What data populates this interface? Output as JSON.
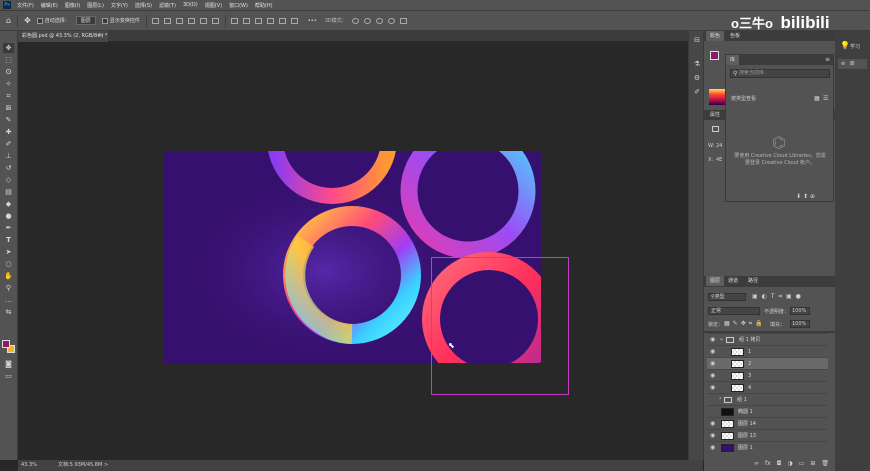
{
  "app": {
    "menus": [
      "文件(F)",
      "编辑(E)",
      "图像(I)",
      "图层(L)",
      "文字(Y)",
      "选择(S)",
      "滤镜(T)",
      "3D(D)",
      "视图(V)",
      "窗口(W)",
      "帮助(H)"
    ],
    "ps_logo": "Ps"
  },
  "options_bar": {
    "auto_select_label": "自动选择：",
    "auto_select_value": "图层",
    "show_transform_label": "显示变换控件",
    "more": "•••"
  },
  "document": {
    "tab_title": "彩色圆.psd @ 43.3% (2, RGB/8#) *",
    "tab_close": "×",
    "zoom": "43.3%",
    "doc_size": "文档:5.93M/45.8M",
    "status_arrow": ">"
  },
  "watermark": {
    "text": "o三牛o",
    "brand": "bilibili"
  },
  "panels": {
    "color_tabs": [
      "颜色",
      "色板"
    ],
    "library_tab": "库",
    "library_search_placeholder": "搜索当前库",
    "library_view_label": "按类型查看",
    "library_message": "要使用 Creative Cloud Libraries，您需要登录 Creative Cloud 帐户。",
    "properties_title": "属性",
    "properties_w_label": "W:",
    "properties_w_value": "24",
    "properties_x_label": "X:",
    "properties_x_value": "4E",
    "right_col_items": [
      "学习",
      "库"
    ],
    "layers_tabs": [
      "图层",
      "通道",
      "路径"
    ],
    "layer_filter": "类型",
    "blend_mode": "正常",
    "opacity_label": "不透明度：",
    "opacity_value": "100%",
    "lock_label": "锁定：",
    "fill_label": "填充：",
    "fill_value": "100%",
    "bottom_icons": [
      "∞",
      "fx",
      "◘",
      "◑",
      "▭",
      "⊞",
      "🗑"
    ]
  },
  "layers": [
    {
      "name": "组 1 拷贝",
      "type": "group",
      "selected": false
    },
    {
      "name": "1",
      "type": "layer",
      "selected": false
    },
    {
      "name": "2",
      "type": "layer",
      "selected": true
    },
    {
      "name": "3",
      "type": "layer",
      "selected": false
    },
    {
      "name": "4",
      "type": "layer",
      "selected": false
    },
    {
      "name": "组 1",
      "type": "group",
      "selected": false
    },
    {
      "name": "椭圆 1",
      "type": "layer",
      "selected": false
    },
    {
      "name": "图层 14",
      "type": "layer",
      "selected": false
    },
    {
      "name": "图层 13",
      "type": "layer",
      "selected": false
    },
    {
      "name": "图层 1",
      "type": "layer",
      "selected": false
    }
  ],
  "colors": {
    "canvas_bg": "#36106e",
    "selection_border": "#c03cc0",
    "foreground": "#8a1a6a",
    "background": "#f0b428"
  }
}
